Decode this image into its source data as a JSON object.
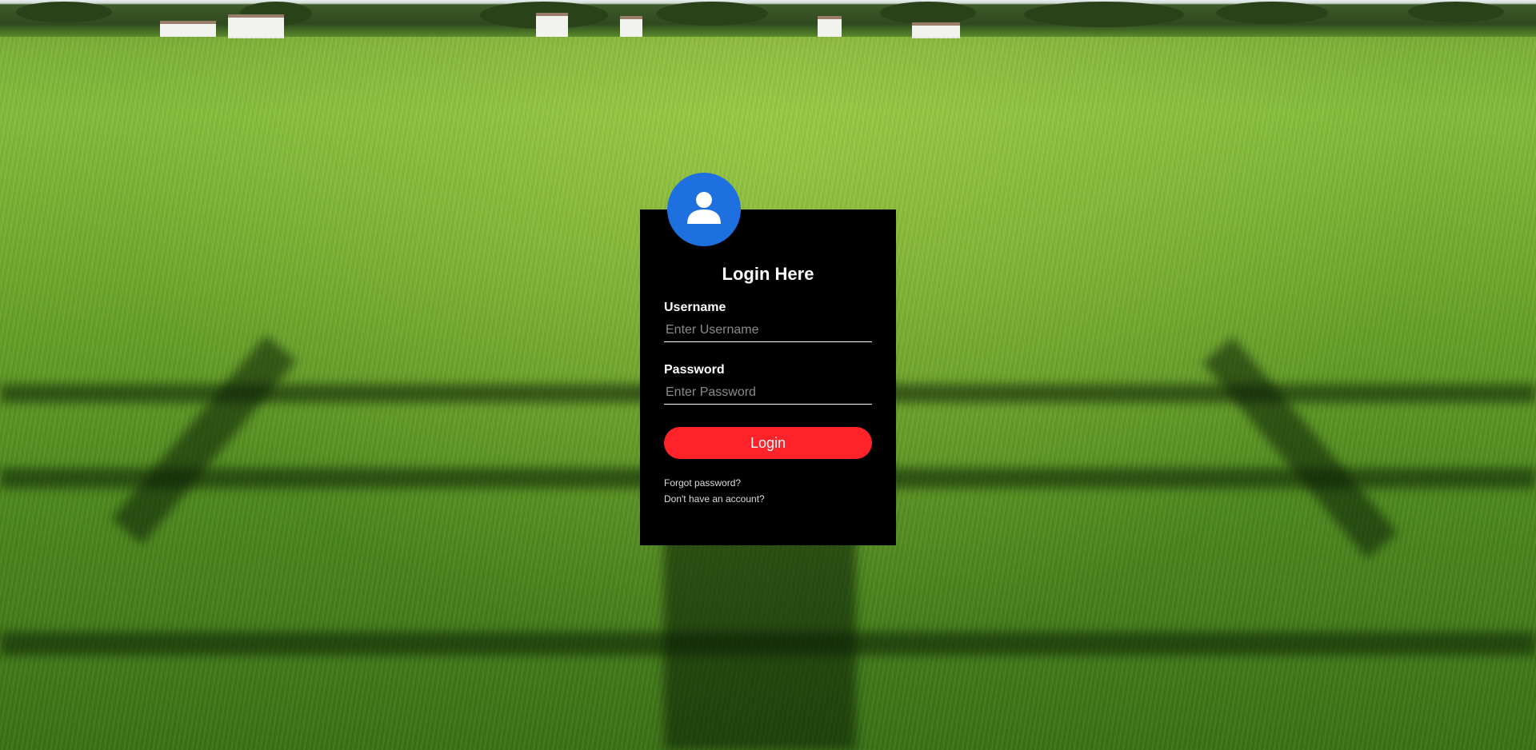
{
  "login": {
    "title": "Login Here",
    "username_label": "Username",
    "username_placeholder": "Enter Username",
    "username_value": "",
    "password_label": "Password",
    "password_placeholder": "Enter Password",
    "password_value": "",
    "submit_label": "Login",
    "forgot_link": "Forgot password?",
    "signup_link": "Don't have an account?"
  },
  "icons": {
    "avatar": "user-icon"
  },
  "colors": {
    "card_bg": "#000000",
    "avatar_bg": "#1e6fe0",
    "button_bg": "#fe2328",
    "text": "#ffffff"
  }
}
